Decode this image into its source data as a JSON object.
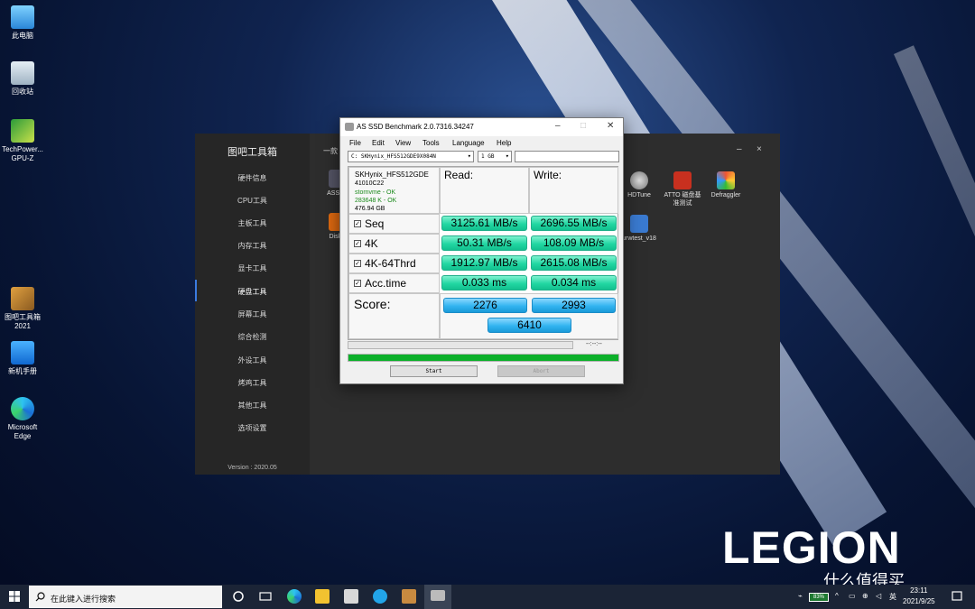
{
  "desktop": {
    "icons": [
      {
        "label": "此电脑"
      },
      {
        "label": "回收站"
      },
      {
        "label": "TechPower... GPU-Z"
      },
      {
        "label": "图吧工具箱 2021"
      },
      {
        "label": "新机手册"
      },
      {
        "label": "Microsoft Edge"
      }
    ],
    "brand": "LEGION",
    "watermark": "什么值得买"
  },
  "toolbox": {
    "title": "图吧工具箱",
    "tab": "一款",
    "menu": [
      "硬件信息",
      "CPU工具",
      "主板工具",
      "内存工具",
      "显卡工具",
      "硬盘工具",
      "屏幕工具",
      "综合检测",
      "外设工具",
      "烤鸡工具",
      "其他工具",
      "选项设置"
    ],
    "active_index": 5,
    "version": "Version : 2020.05",
    "apps": [
      {
        "label": "ASSSD"
      },
      {
        "label": "DiskG"
      },
      {
        "label": "HDTune"
      },
      {
        "label": "ATTO 磁盘基准测试"
      },
      {
        "label": "Defraggler"
      },
      {
        "label": "urwtest_v18"
      }
    ],
    "minimize": "–",
    "close": "×"
  },
  "asssd": {
    "title": "AS SSD Benchmark 2.0.7316.34247",
    "menu": [
      "File",
      "Edit",
      "View",
      "Tools",
      "Language",
      "Help"
    ],
    "drive_select": "C: SKHynix_HFS512GDE9X084N",
    "size_select": "1 GB",
    "info": {
      "model": "SKHynix_HFS512GDE",
      "firmware": "41010C22",
      "driver": "stornvme - OK",
      "alignment": "283648 K - OK",
      "capacity": "476.94 GB"
    },
    "headers": {
      "read": "Read:",
      "write": "Write:"
    },
    "rows": [
      {
        "label": "Seq",
        "read": "3125.61 MB/s",
        "write": "2696.55 MB/s"
      },
      {
        "label": "4K",
        "read": "50.31 MB/s",
        "write": "108.09 MB/s"
      },
      {
        "label": "4K-64Thrd",
        "read": "1912.97 MB/s",
        "write": "2615.08 MB/s"
      },
      {
        "label": "Acc.time",
        "read": "0.033 ms",
        "write": "0.034 ms"
      }
    ],
    "score_label": "Score:",
    "score_read": "2276",
    "score_write": "2993",
    "score_total": "6410",
    "elapsed": "--:--:--",
    "progress_top": 0.0,
    "progress_bottom": 1.0,
    "start_label": "Start",
    "abort_label": "Abort",
    "progress_color": "#0cb02a",
    "value_color": "#22d7a3",
    "score_color": "#32b4f0"
  },
  "taskbar": {
    "search_placeholder": "在此键入进行搜索",
    "battery": "83%",
    "ime": "英",
    "time": "23:11",
    "date": "2021/9/25"
  }
}
